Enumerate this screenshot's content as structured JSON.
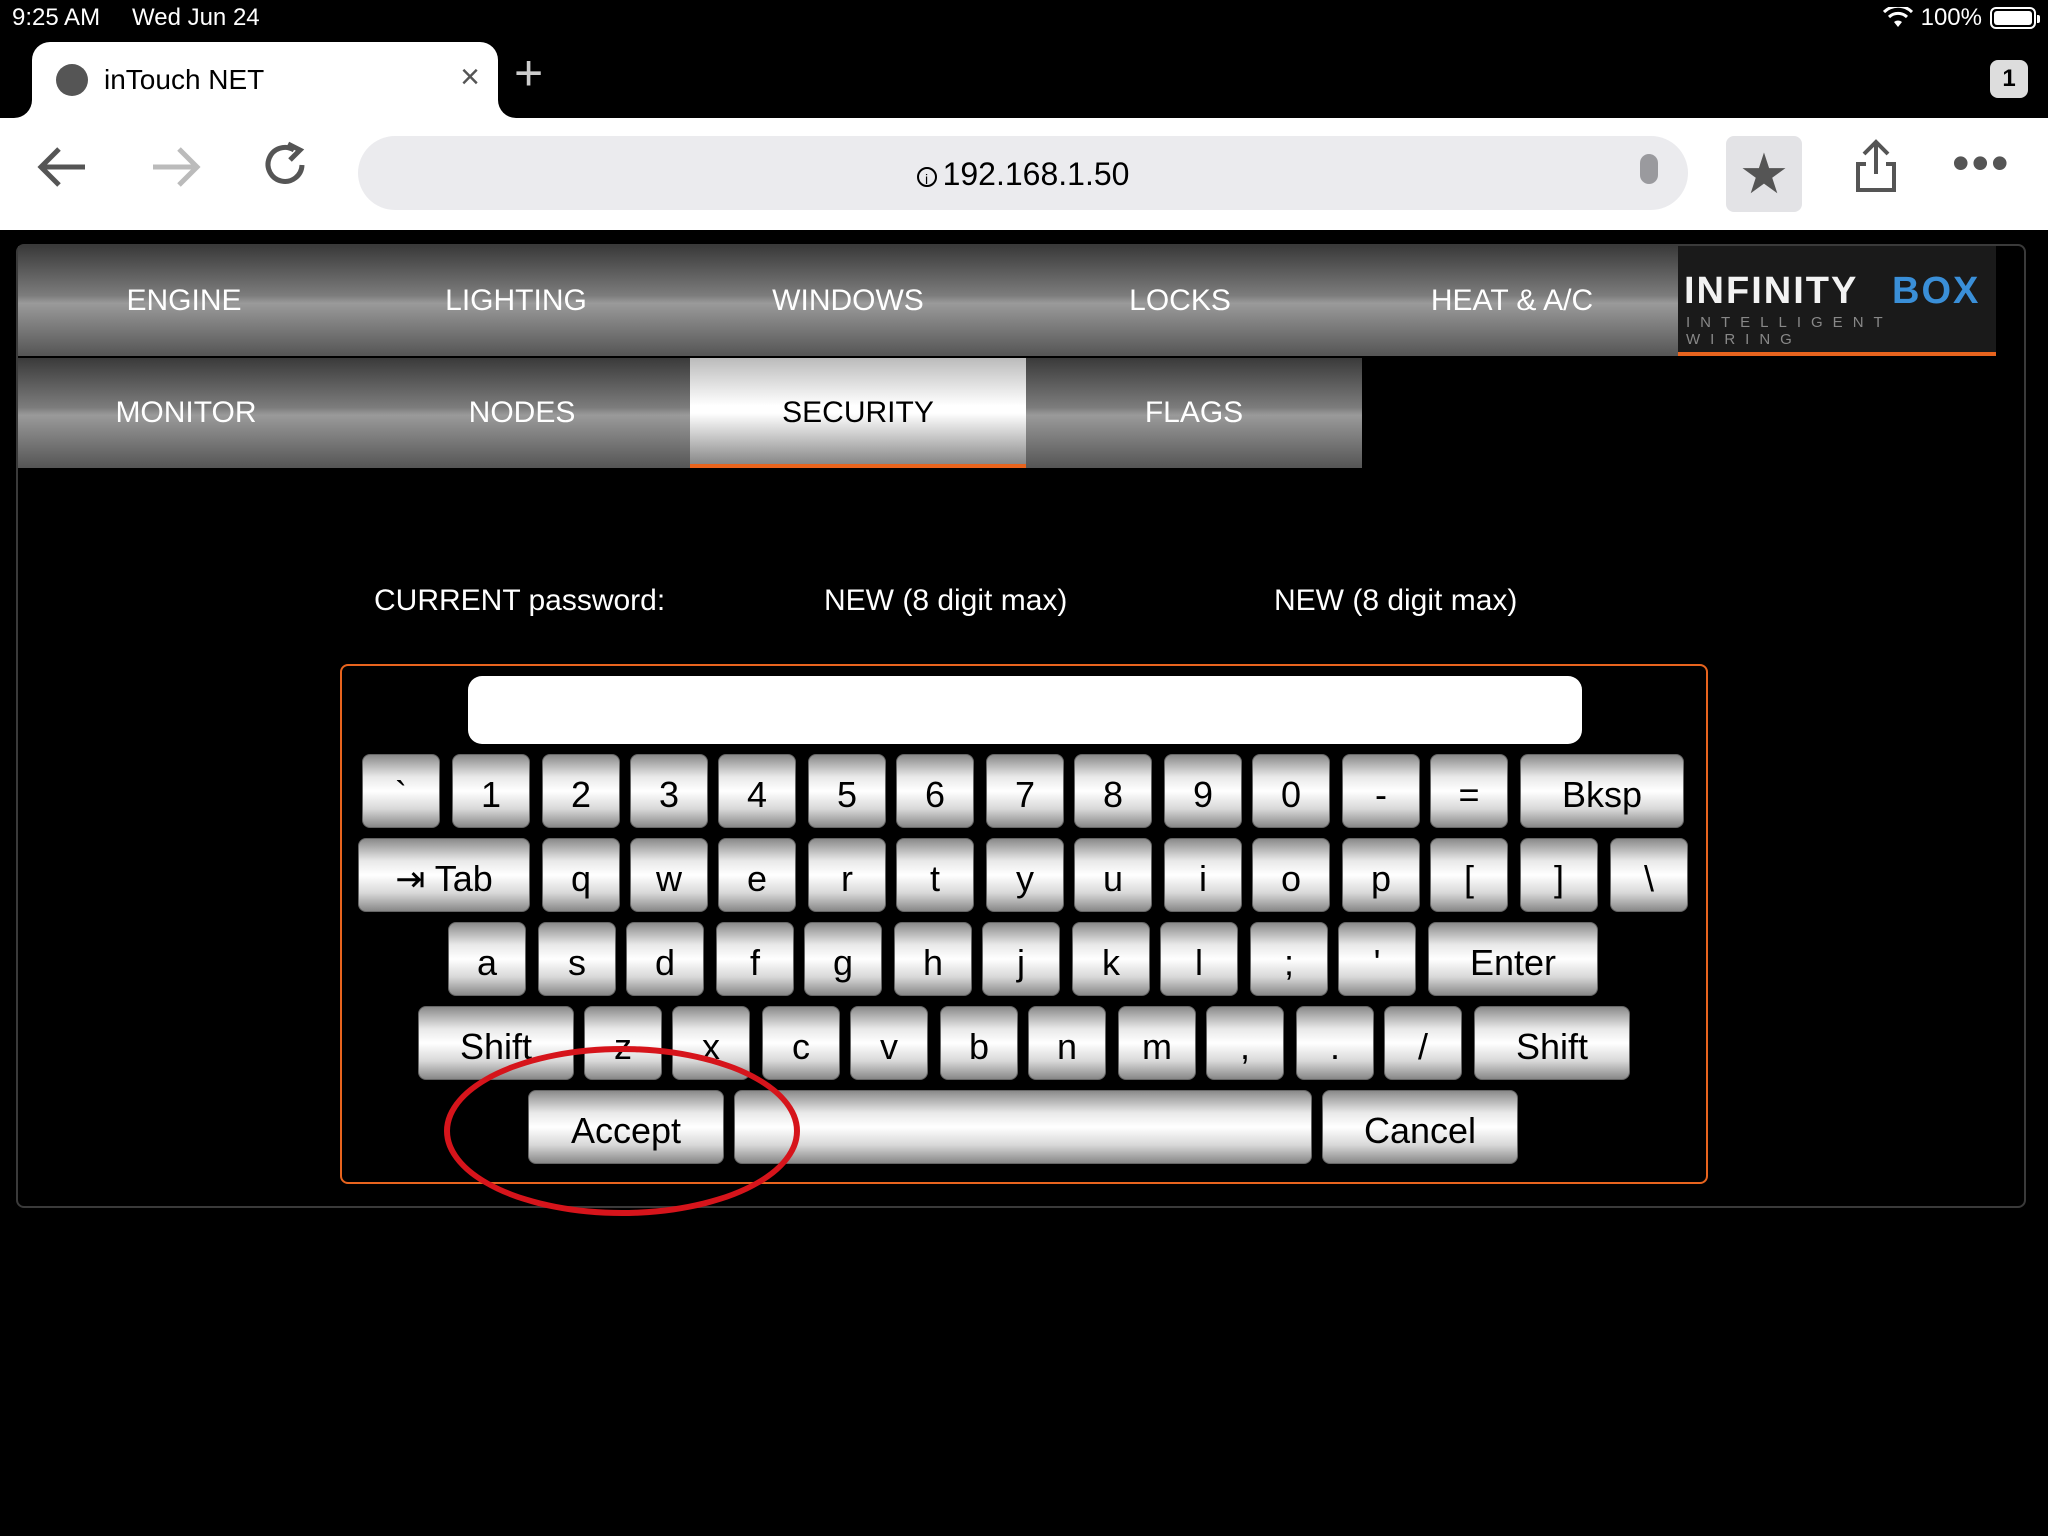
{
  "status_bar": {
    "time": "9:25 AM",
    "date": "Wed Jun 24",
    "battery": "100%"
  },
  "browser": {
    "tab_title": "inTouch NET",
    "tab_count": "1",
    "url": "192.168.1.50",
    "icons": {
      "back": "arrow-left",
      "forward": "arrow-right",
      "reload": "reload",
      "close": "×",
      "new_tab": "+",
      "bookmark": "★",
      "share": "share",
      "more": "•••"
    }
  },
  "nav": {
    "row1": [
      "ENGINE",
      "LIGHTING",
      "WINDOWS",
      "LOCKS",
      "HEAT & A/C"
    ],
    "row2": [
      "MONITOR",
      "NODES",
      "SECURITY",
      "FLAGS"
    ],
    "active": "SECURITY",
    "logo": {
      "brand_main": "INFINITY",
      "brand_accent": "BOX",
      "tagline": "INTELLIGENT WIRING"
    }
  },
  "security": {
    "current_label": "CURRENT password:",
    "new_label_1": "NEW (8 digit max)",
    "new_label_2": "NEW (8 digit max)",
    "input_value": ""
  },
  "keyboard": {
    "row1": [
      "`",
      "1",
      "2",
      "3",
      "4",
      "5",
      "6",
      "7",
      "8",
      "9",
      "0",
      "-",
      "=",
      "Bksp"
    ],
    "row2": [
      "⇥ Tab",
      "q",
      "w",
      "e",
      "r",
      "t",
      "y",
      "u",
      "i",
      "o",
      "p",
      "[",
      "]",
      "\\"
    ],
    "row3": [
      "a",
      "s",
      "d",
      "f",
      "g",
      "h",
      "j",
      "k",
      "l",
      ";",
      "'",
      "Enter"
    ],
    "row4": [
      "Shift",
      "z",
      "x",
      "c",
      "v",
      "b",
      "n",
      "m",
      ",",
      ".",
      "/",
      "Shift"
    ],
    "row5": [
      "Accept",
      "",
      "Cancel"
    ]
  },
  "colors": {
    "accent": "#e8641e",
    "highlight_circle": "#d6141b",
    "logo_accent": "#3a8fd8"
  }
}
